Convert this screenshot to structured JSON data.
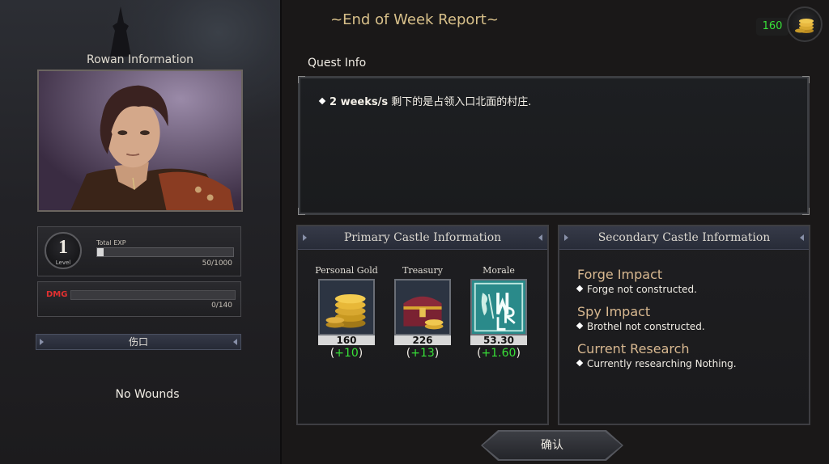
{
  "character": {
    "title": "Rowan Information",
    "level": "1",
    "level_label": "Level",
    "exp_label": "Total EXP",
    "exp_value": "50/1000",
    "exp_fraction": 0.05,
    "dmg_label": "DMG",
    "dmg_value": "0/140",
    "dmg_fraction": 0,
    "wounds_header": "伤口",
    "wounds_status": "No Wounds"
  },
  "report": {
    "title": "~End of Week Report~",
    "gold_counter": "160"
  },
  "quest": {
    "title": "Quest Info",
    "time_bold": "2 weeks/s",
    "text": " 剩下的是占领入口北面的村庄."
  },
  "primary_castle": {
    "header": "Primary Castle Information",
    "stats": [
      {
        "label": "Personal Gold",
        "icon": "gold-coins-icon",
        "value": "160",
        "delta": "+10"
      },
      {
        "label": "Treasury",
        "icon": "treasure-chest-icon",
        "value": "226",
        "delta": "+13"
      },
      {
        "label": "Morale",
        "icon": "morale-emblem-icon",
        "value": "53.30",
        "delta": "+1.60"
      }
    ]
  },
  "secondary_castle": {
    "header": "Secondary Castle Information",
    "sections": [
      {
        "title": "Forge Impact",
        "line": "Forge not constructed."
      },
      {
        "title": "Spy Impact",
        "line": "Brothel not constructed."
      },
      {
        "title": "Current Research",
        "line": "Currently researching Nothing."
      }
    ]
  },
  "confirm_label": "确认",
  "colors": {
    "accent_gold": "#d8c08a",
    "positive": "#38e038",
    "damage": "#e23030",
    "section_title": "#d8b890"
  }
}
